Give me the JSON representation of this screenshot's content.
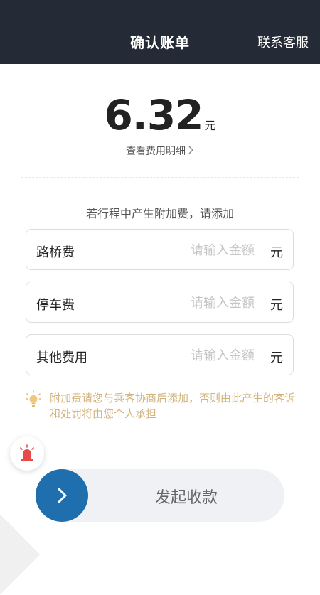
{
  "header": {
    "title": "确认账单",
    "contact_label": "联系客服"
  },
  "bill": {
    "amount": "6.32",
    "currency": "元",
    "detail_link": "查看费用明细"
  },
  "extra_fees": {
    "hint": "若行程中产生附加费，请添加",
    "rows": [
      {
        "label": "路桥费",
        "placeholder": "请输入金额",
        "unit": "元"
      },
      {
        "label": "停车费",
        "placeholder": "请输入金额",
        "unit": "元"
      },
      {
        "label": "其他费用",
        "placeholder": "请输入金额",
        "unit": "元"
      }
    ]
  },
  "notice": {
    "text": "附加费请您与乘客协商后添加，否则由此产生的客诉和处罚将由您个人承担",
    "icon": "lightbulb-icon",
    "color": "#d1b37d"
  },
  "alarm": {
    "icon": "alarm-siren-icon",
    "color": "#e84a4a"
  },
  "slide_action": {
    "label": "发起收款",
    "icon": "chevron-right-icon",
    "accent": "#1f6fae"
  }
}
